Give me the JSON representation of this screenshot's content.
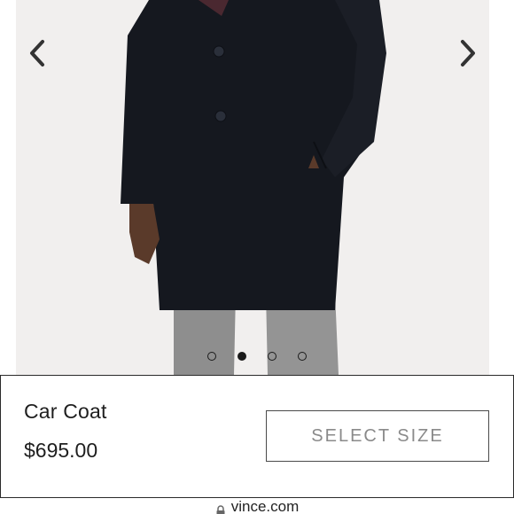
{
  "gallery": {
    "prev_icon": "chevron-left-icon",
    "next_icon": "chevron-right-icon",
    "image_count": 4,
    "active_index": 1
  },
  "product": {
    "name": "Car Coat",
    "price": "$695.00",
    "select_size_label": "SELECT SIZE"
  },
  "browser": {
    "url": "vince.com",
    "lock_icon": "lock-icon"
  },
  "colors": {
    "coat": "#15181f",
    "pants": "#8f8f8f",
    "background": "#f1efee",
    "accent": "#1a1a1a"
  }
}
